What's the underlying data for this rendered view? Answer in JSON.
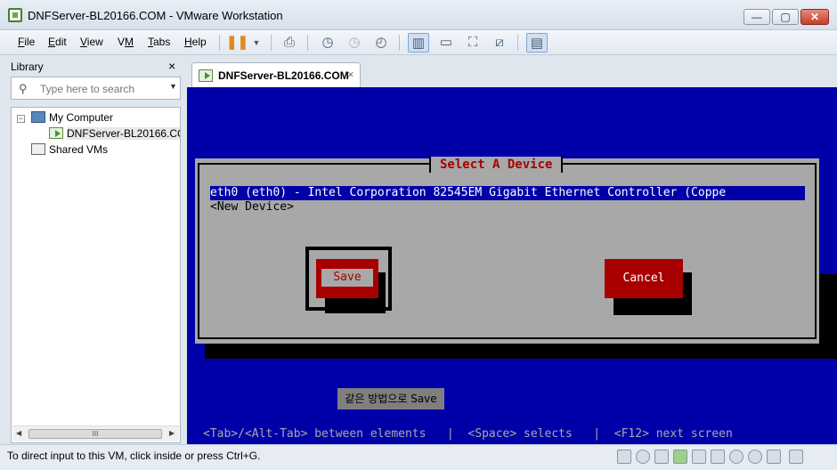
{
  "window": {
    "title": "DNFServer-BL20166.COM - VMware Workstation",
    "min_label": "—",
    "max_label": "▢",
    "close_label": "✕"
  },
  "menu": {
    "items": [
      {
        "label": "File",
        "accel": "F"
      },
      {
        "label": "Edit",
        "accel": "E"
      },
      {
        "label": "View",
        "accel": "V"
      },
      {
        "label": "VM",
        "accel": "M"
      },
      {
        "label": "Tabs",
        "accel": "T"
      },
      {
        "label": "Help",
        "accel": "H"
      }
    ]
  },
  "toolbar": {
    "icons": [
      "pause-icon",
      "dropdown-icon",
      "send-ctrl-alt-del-icon",
      "snapshot-icon",
      "revert-snapshot-icon",
      "snapshot-manager-icon",
      "library-view-icon",
      "console-view-icon",
      "fullscreen-icon",
      "unity-icon",
      "thumbnail-bar-icon"
    ]
  },
  "library": {
    "title": "Library",
    "close": "×",
    "search_placeholder": "Type here to search",
    "tree": [
      {
        "label": "My Computer",
        "icon": "computer-icon"
      },
      {
        "label": "DNFServer-BL20166.COM",
        "icon": "vm-running-icon",
        "selected": true
      },
      {
        "label": "Shared VMs",
        "icon": "shared-vms-icon"
      }
    ],
    "scroll_thumb": "III"
  },
  "tab": {
    "label": "DNFServer-BL20166.COM",
    "close": "×"
  },
  "vm": {
    "dialog_title": "Select A Device",
    "devices": [
      "eth0 (eth0) - Intel Corporation 82545EM Gigabit Ethernet Controller (Coppe",
      "<New Device>"
    ],
    "save_label": "Save",
    "cancel_label": "Cancel",
    "tooltip": "같은 방법으로 Save",
    "helpline": "<Tab>/<Alt-Tab> between elements   |  <Space> selects   |  <F12> next screen",
    "colors": {
      "background": "#0000a8",
      "dialog": "#a8a8a8",
      "accent": "#a80000"
    }
  },
  "status": {
    "message": "To direct input to this VM, click inside or press Ctrl+G.",
    "icons": [
      "hard-disk-icon",
      "cd-icon",
      "floppy-icon",
      "network-icon",
      "usb-icon",
      "sound-icon",
      "bluetooth-icon",
      "printer-icon",
      "display-icon",
      "message-icon"
    ]
  }
}
